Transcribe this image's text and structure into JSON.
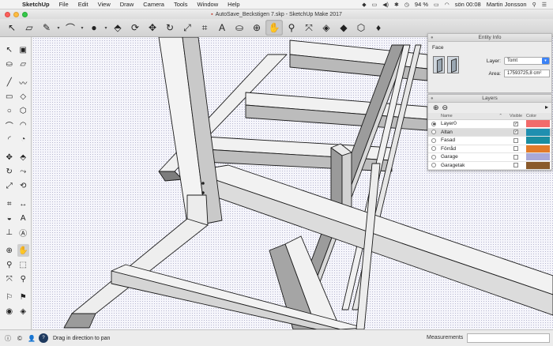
{
  "menubar": {
    "apple": "",
    "app_name": "SketchUp",
    "items": [
      "File",
      "Edit",
      "View",
      "Draw",
      "Camera",
      "Tools",
      "Window",
      "Help"
    ],
    "battery": "94 %",
    "clock": "sön 00:08",
    "user": "Martin Jonsson"
  },
  "window": {
    "title": "AutoSave_Beckstigen 7.skp - SketchUp Make 2017"
  },
  "toolbar": {
    "tools": [
      {
        "name": "select-tool",
        "glyph": "↖"
      },
      {
        "name": "eraser-tool",
        "glyph": "▱"
      },
      {
        "name": "line-tool",
        "glyph": "✎"
      },
      {
        "name": "line-tool-caret",
        "glyph": "▾",
        "caret": true
      },
      {
        "name": "arc-tool",
        "glyph": "⌒"
      },
      {
        "name": "arc-tool-caret",
        "glyph": "▾",
        "caret": true
      },
      {
        "name": "circle-tool",
        "glyph": "●"
      },
      {
        "name": "circle-tool-caret",
        "glyph": "▾",
        "caret": true
      },
      {
        "name": "pushpull-tool",
        "glyph": "⬘"
      },
      {
        "name": "offset-tool",
        "glyph": "⟳"
      },
      {
        "name": "move-tool",
        "glyph": "✥"
      },
      {
        "name": "rotate-tool",
        "glyph": "↻"
      },
      {
        "name": "scale-tool",
        "glyph": "⤢"
      },
      {
        "name": "tape-measure-tool",
        "glyph": "⌗"
      },
      {
        "name": "text-tool",
        "glyph": "A"
      },
      {
        "name": "paint-bucket-tool",
        "glyph": "⛀"
      },
      {
        "name": "orbit-tool",
        "glyph": "⊕"
      },
      {
        "name": "pan-tool",
        "glyph": "✋",
        "active": true
      },
      {
        "name": "zoom-tool",
        "glyph": "⚲"
      },
      {
        "name": "zoom-extents-tool",
        "glyph": "⤧"
      },
      {
        "name": "warehouse-tool",
        "glyph": "◈"
      },
      {
        "name": "extension-warehouse-tool",
        "glyph": "◆"
      },
      {
        "name": "share-model-tool",
        "glyph": "⬡"
      },
      {
        "name": "ruby-tool",
        "glyph": "♦"
      }
    ]
  },
  "palette": {
    "tools": [
      {
        "name": "select-tool",
        "glyph": "↖"
      },
      {
        "name": "make-component-tool",
        "glyph": "▣"
      },
      {
        "name": "paint-bucket-tool",
        "glyph": "⛀"
      },
      {
        "name": "eraser-tool",
        "glyph": "▱"
      },
      {
        "name": "line-tool",
        "glyph": "╱"
      },
      {
        "name": "freehand-tool",
        "glyph": "〰"
      },
      {
        "name": "rectangle-tool",
        "glyph": "▭"
      },
      {
        "name": "rotated-rectangle-tool",
        "glyph": "◇"
      },
      {
        "name": "circle-tool",
        "glyph": "○"
      },
      {
        "name": "polygon-tool",
        "glyph": "⬡"
      },
      {
        "name": "arc-tool",
        "glyph": "⌒"
      },
      {
        "name": "two-point-arc-tool",
        "glyph": "◠"
      },
      {
        "name": "three-point-arc-tool",
        "glyph": "◜"
      },
      {
        "name": "pie-tool",
        "glyph": "◔"
      },
      {
        "name": "move-tool",
        "glyph": "✥"
      },
      {
        "name": "pushpull-tool",
        "glyph": "⬘"
      },
      {
        "name": "rotate-tool",
        "glyph": "↻"
      },
      {
        "name": "follow-me-tool",
        "glyph": "⤳"
      },
      {
        "name": "scale-tool",
        "glyph": "⤢"
      },
      {
        "name": "offset-tool",
        "glyph": "⟲"
      },
      {
        "name": "tape-measure-tool",
        "glyph": "⌗"
      },
      {
        "name": "dimension-tool",
        "glyph": "↔"
      },
      {
        "name": "protractor-tool",
        "glyph": "◒"
      },
      {
        "name": "text-tool",
        "glyph": "A"
      },
      {
        "name": "axes-tool",
        "glyph": "⊥"
      },
      {
        "name": "3d-text-tool",
        "glyph": "Ⓐ"
      },
      {
        "name": "orbit-tool",
        "glyph": "⊕"
      },
      {
        "name": "pan-tool",
        "glyph": "✋",
        "active": true
      },
      {
        "name": "zoom-tool",
        "glyph": "⚲"
      },
      {
        "name": "zoom-window-tool",
        "glyph": "⬚"
      },
      {
        "name": "zoom-extents-tool",
        "glyph": "⤧"
      },
      {
        "name": "previous-view-tool",
        "glyph": "⚲"
      },
      {
        "name": "position-camera-tool",
        "glyph": "⚐"
      },
      {
        "name": "walk-tool",
        "glyph": "⚑"
      },
      {
        "name": "look-around-tool",
        "glyph": "◉"
      },
      {
        "name": "section-plane-tool",
        "glyph": "◈"
      }
    ]
  },
  "entity_info": {
    "title": "Entity Info",
    "type": "Face",
    "layer_label": "Layer:",
    "layer_value": "Tomt",
    "area_label": "Area:",
    "area_value": "17593725,8 cm²"
  },
  "layers": {
    "title": "Layers",
    "add_glyph": "⊕",
    "remove_glyph": "⊖",
    "details_glyph": "▸",
    "col_name": "Name",
    "col_visible": "Visible",
    "col_color": "Color",
    "rows": [
      {
        "name": "Layer0",
        "active": true,
        "visible": true,
        "color": "#f26b6b"
      },
      {
        "name": "Altan",
        "active": false,
        "visible": true,
        "color": "#1f8fb0",
        "selected": true
      },
      {
        "name": "Fasad",
        "active": false,
        "visible": false,
        "color": "#1a8da1"
      },
      {
        "name": "Förråd",
        "active": false,
        "visible": false,
        "color": "#e27b2a"
      },
      {
        "name": "Garage",
        "active": false,
        "visible": false,
        "color": "#a9a9d8"
      },
      {
        "name": "Garagetak",
        "active": false,
        "visible": false,
        "color": "#8a5a2b"
      }
    ]
  },
  "status": {
    "message": "Drag in direction to pan",
    "measurements_label": "Measurements",
    "measurements_value": ""
  }
}
